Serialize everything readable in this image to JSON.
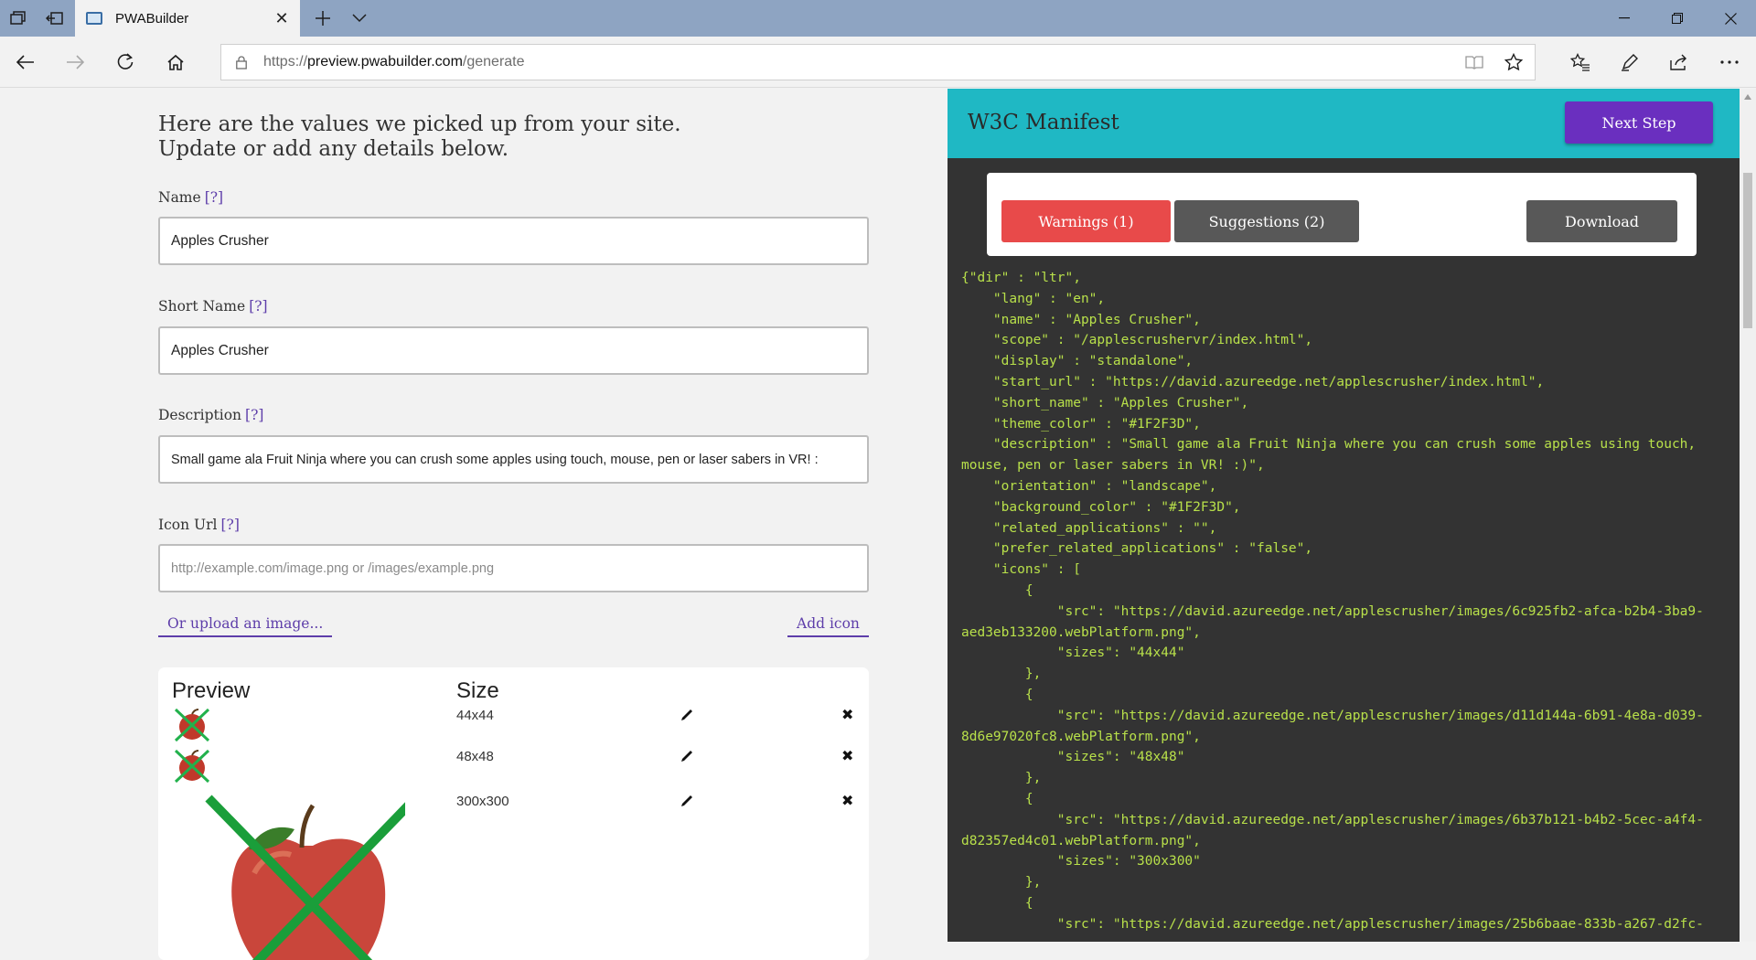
{
  "browser": {
    "tab_title": "PWABuilder",
    "url_scheme": "https://",
    "url_host": "preview.pwabuilder.com",
    "url_path": "/generate"
  },
  "form": {
    "heading_line1": "Here are the values we picked up from your site.",
    "heading_line2": "Update or add any details below.",
    "help_text": "[?]",
    "name_label": "Name",
    "name_value": "Apples Crusher",
    "short_name_label": "Short Name",
    "short_name_value": "Apples Crusher",
    "description_label": "Description",
    "description_value": "Small game ala Fruit Ninja where you can crush some apples using touch, mouse, pen or laser sabers in VR! :",
    "icon_url_label": "Icon Url",
    "icon_url_placeholder": "http://example.com/image.png or /images/example.png",
    "upload_link": "Or upload an image...",
    "add_icon_link": "Add icon"
  },
  "preview_table": {
    "col_preview": "Preview",
    "col_size": "Size",
    "rows": [
      {
        "size": "44x44"
      },
      {
        "size": "48x48"
      },
      {
        "size": "300x300"
      }
    ]
  },
  "manifest_panel": {
    "title": "W3C Manifest",
    "next_step": "Next Step",
    "warnings": "Warnings (1)",
    "suggestions": "Suggestions (2)",
    "download": "Download",
    "code": "{\"dir\" : \"ltr\",\n    \"lang\" : \"en\",\n    \"name\" : \"Apples Crusher\",\n    \"scope\" : \"/applescrushervr/index.html\",\n    \"display\" : \"standalone\",\n    \"start_url\" : \"https://david.azureedge.net/applescrusher/index.html\",\n    \"short_name\" : \"Apples Crusher\",\n    \"theme_color\" : \"#1F2F3D\",\n    \"description\" : \"Small game ala Fruit Ninja where you can crush some apples using touch,\nmouse, pen or laser sabers in VR! :)\",\n    \"orientation\" : \"landscape\",\n    \"background_color\" : \"#1F2F3D\",\n    \"related_applications\" : \"\",\n    \"prefer_related_applications\" : \"false\",\n    \"icons\" : [\n        {\n            \"src\": \"https://david.azureedge.net/applescrusher/images/6c925fb2-afca-b2b4-3ba9-\naed3eb133200.webPlatform.png\",\n            \"sizes\": \"44x44\"\n        },\n        {\n            \"src\": \"https://david.azureedge.net/applescrusher/images/d11d144a-6b91-4e8a-d039-\n8d6e97020fc8.webPlatform.png\",\n            \"sizes\": \"48x48\"\n        },\n        {\n            \"src\": \"https://david.azureedge.net/applescrusher/images/6b37b121-b4b2-5cec-a4f4-\nd82357ed4c01.webPlatform.png\",\n            \"sizes\": \"300x300\"\n        },\n        {\n            \"src\": \"https://david.azureedge.net/applescrusher/images/25b6baae-833b-a267-d2fc-"
  },
  "colors": {
    "accent_teal": "#1fb8c4",
    "next_purple": "#6a2fbf",
    "warning_red": "#e84a4a",
    "code_green": "#b8e04a",
    "panel_dark": "#333333"
  }
}
